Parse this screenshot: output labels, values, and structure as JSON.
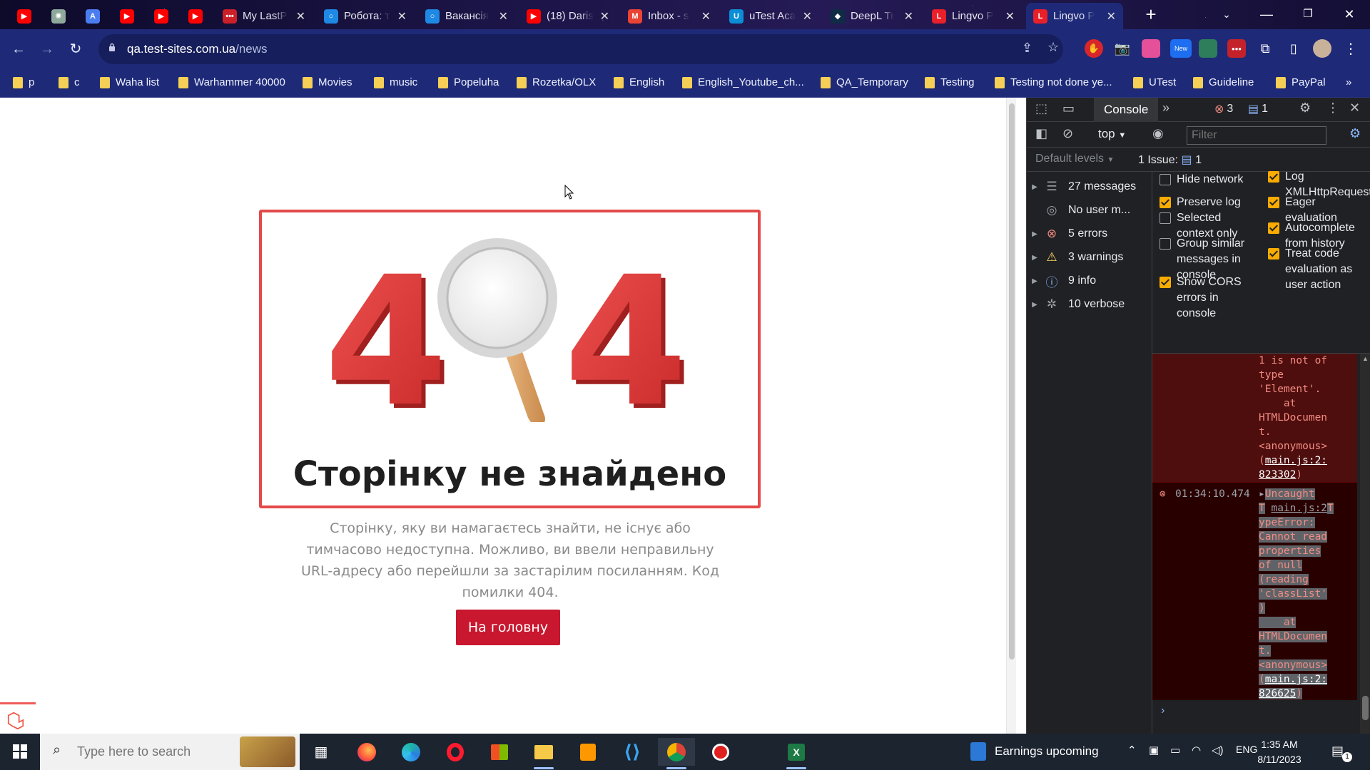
{
  "browser": {
    "tabs": [
      {
        "title": "",
        "favicon": "youtube-icon",
        "color": "#ff0000",
        "pinned": true
      },
      {
        "title": "",
        "favicon": "chatgpt-icon",
        "color": "#8fa89c",
        "pinned": true
      },
      {
        "title": "",
        "favicon": "arrow-app-icon",
        "color": "#4a7df0",
        "pinned": true
      },
      {
        "title": "",
        "favicon": "youtube-icon",
        "color": "#ff0000",
        "pinned": true
      },
      {
        "title": "",
        "favicon": "youtube-icon",
        "color": "#ff0000",
        "pinned": true
      },
      {
        "title": "",
        "favicon": "youtube-icon",
        "color": "#ff0000",
        "pinned": true
      },
      {
        "title": "My LastP",
        "favicon": "lastpass-icon",
        "color": "#cc2029"
      },
      {
        "title": "Робота: т",
        "favicon": "robota-icon",
        "color": "#1e88e5"
      },
      {
        "title": "Вакансія",
        "favicon": "robota-icon",
        "color": "#1e88e5"
      },
      {
        "title": "(18) Daris",
        "favicon": "youtube-icon",
        "color": "#ff0000"
      },
      {
        "title": "Inbox - s",
        "favicon": "gmail-icon",
        "color": "#ea4335"
      },
      {
        "title": "uTest Aca",
        "favicon": "utest-icon",
        "color": "#0a8fd6"
      },
      {
        "title": "DeepL Tr",
        "favicon": "deepl-icon",
        "color": "#0f2b46"
      },
      {
        "title": "Lingvo P",
        "favicon": "lingvo-icon",
        "color": "#e8202a"
      },
      {
        "title": "Lingvo P",
        "favicon": "lingvo-icon",
        "color": "#e8202a",
        "active": true
      }
    ],
    "url_host": "qa.test-sites.com.ua",
    "url_path": "/news",
    "bookmarks": [
      "p",
      "c",
      "Waha list",
      "Warhammer 40000",
      "Movies",
      "music",
      "Popeluha",
      "Rozetka/OLX",
      "English",
      "English_Youtube_ch...",
      "QA_Temporary",
      "Testing",
      "Testing not done ye...",
      "UTest",
      "Guideline",
      "PayPal"
    ],
    "extension_badge": "New"
  },
  "page": {
    "big_digit_left": "4",
    "big_digit_right": "4",
    "heading": "Сторінку не знайдено",
    "description": "Сторінку, яку ви намагаєтесь знайти, не існує або тимчасово недоступна. Можливо, ви ввели неправильну URL-адресу або перейшли за застарілим посиланням. Код помилки 404.",
    "home_button": "На головну",
    "accent": "#c8172e",
    "frame_color": "#e34a4a"
  },
  "devtools": {
    "tab_label": "Console",
    "error_count": "3",
    "message_count": "1",
    "context": "top",
    "filter_placeholder": "Filter",
    "levels_label": "Default levels",
    "issue_label": "1 Issue:",
    "issue_count": "1",
    "sidebar": [
      {
        "label": "27 messages",
        "icon": "list-icon",
        "expandable": true
      },
      {
        "label": "No user m...",
        "icon": "user-icon",
        "expandable": false
      },
      {
        "label": "5 errors",
        "icon": "error-icon",
        "expandable": true
      },
      {
        "label": "3 warnings",
        "icon": "warning-icon",
        "expandable": true
      },
      {
        "label": "9 info",
        "icon": "info-icon",
        "expandable": true
      },
      {
        "label": "10 verbose",
        "icon": "bug-icon",
        "expandable": true
      }
    ],
    "settings_left": [
      {
        "label": "Hide network",
        "checked": false
      },
      {
        "label": "Preserve log",
        "checked": true
      },
      {
        "label": "Selected context only",
        "checked": false
      },
      {
        "label": "Group similar messages in console",
        "checked": false
      },
      {
        "label": "Show CORS errors in console",
        "checked": true
      }
    ],
    "settings_right": [
      {
        "label": "Log XMLHttpRequests",
        "checked": true
      },
      {
        "label": "Eager evaluation",
        "checked": true
      },
      {
        "label": "Autocomplete from history",
        "checked": true
      },
      {
        "label": "Treat code evaluation as user action",
        "checked": true
      }
    ],
    "log_error1_text": "1 is not of\ntype\n'Element'.\n    at\nHTMLDocumen\nt.\n<anonymous>\n(",
    "log_error1_link": "main.js:2:\n823302",
    "log_error2_time": "01:34:10.474",
    "log_error2_head": "Uncaught",
    "log_error2_source": "main.js:2",
    "log_error2_text": "T\nypeError:\nCannot read\nproperties\nof null\n(reading\n'classList'\n)\n    at\nHTMLDocumen\nt.\n<anonymous>\n(",
    "log_error2_link": "main.js:2:\n826625"
  },
  "taskbar": {
    "search_placeholder": "Type here to search",
    "news_label": "Earnings upcoming",
    "language": "ENG",
    "time": "1:35 AM",
    "date": "8/11/2023",
    "notification_count": "1"
  }
}
